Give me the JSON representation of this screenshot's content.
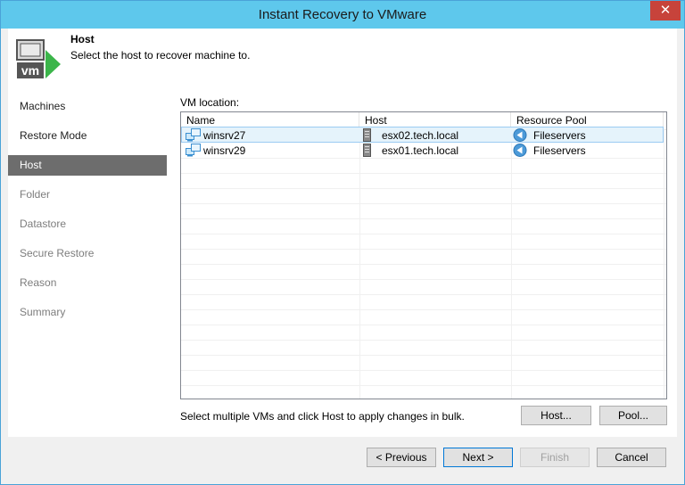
{
  "window": {
    "title": "Instant Recovery to VMware"
  },
  "header": {
    "title": "Host",
    "subtitle": "Select the host to recover machine to."
  },
  "sidebar": {
    "items": [
      {
        "label": "Machines",
        "state": "normal"
      },
      {
        "label": "Restore Mode",
        "state": "normal"
      },
      {
        "label": "Host",
        "state": "active"
      },
      {
        "label": "Folder",
        "state": "disabled"
      },
      {
        "label": "Datastore",
        "state": "disabled"
      },
      {
        "label": "Secure Restore",
        "state": "disabled"
      },
      {
        "label": "Reason",
        "state": "disabled"
      },
      {
        "label": "Summary",
        "state": "disabled"
      }
    ]
  },
  "content": {
    "vm_location_label": "VM location:",
    "columns": [
      "Name",
      "Host",
      "Resource Pool"
    ],
    "rows": [
      {
        "name": "winsrv27",
        "host": "esx02.tech.local",
        "pool": "Fileservers",
        "selected": true
      },
      {
        "name": "winsrv29",
        "host": "esx01.tech.local",
        "pool": "Fileservers",
        "selected": false
      }
    ],
    "hint": "Select multiple VMs and click Host to apply changes in bulk.",
    "host_button": "Host...",
    "pool_button": "Pool..."
  },
  "footer": {
    "previous": "< Previous",
    "next": "Next >",
    "finish": "Finish",
    "cancel": "Cancel"
  },
  "colors": {
    "titlebar": "#5ec8ec",
    "close": "#c7433b",
    "sidebar_active": "#6d6d6d",
    "selection": "#e5f3fb",
    "vm_arrow": "#3bb54a"
  }
}
